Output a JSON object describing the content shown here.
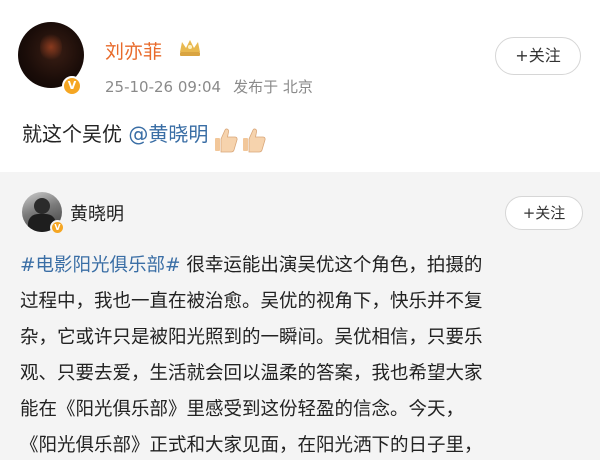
{
  "post": {
    "author": "刘亦菲",
    "author_badge_icon": "crown-icon",
    "date": "25-10-26 09:04",
    "location": "发布于 北京",
    "follow_label": "+关注",
    "text_prefix": "就这个吴优 ",
    "mention": "@黄晓明",
    "reaction_icons": [
      "thumbs-up-icon",
      "thumbs-up-icon"
    ]
  },
  "repost": {
    "author": "黄晓明",
    "follow_label": "+关注",
    "hashtag": "#电影阳光俱乐部#",
    "lines": [
      " 很幸运能出演吴优这个角色，拍摄的",
      "过程中，我也一直在被治愈。吴优的视角下，快乐并不复",
      "杂，它或许只是被阳光照到的一瞬间。吴优相信，只要乐",
      "观、只要去爱，生活就会回以温柔的答案，我也希望大家",
      "能在《阳光俱乐部》里感受到这份轻盈的信念。今天，",
      "《阳光俱乐部》正式和大家见面，在阳光洒下的日子里，"
    ]
  },
  "colors": {
    "username": "#e86a2a",
    "link": "#3a6ea5",
    "verified_badge": "#f5a623",
    "repost_bg": "#f4f4f4"
  }
}
